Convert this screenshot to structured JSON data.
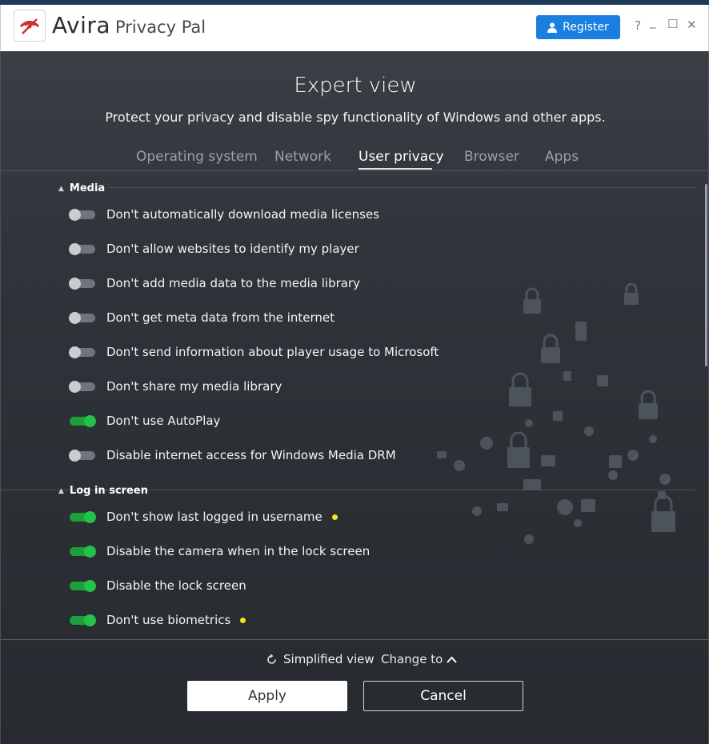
{
  "app": {
    "brand": "Avira",
    "product": "Privacy Pal",
    "register_label": "Register",
    "window_controls": {
      "help": "?",
      "minimize": "_",
      "maximize": "☐",
      "close": "✕"
    }
  },
  "header": {
    "title": "Expert view",
    "subtitle": "Protect your privacy and disable spy functionality of Windows and other apps."
  },
  "tabs": [
    {
      "label": "Operating system",
      "active": false
    },
    {
      "label": "Network",
      "active": false
    },
    {
      "label": "User privacy",
      "active": true
    },
    {
      "label": "Browser",
      "active": false
    },
    {
      "label": "Apps",
      "active": false
    }
  ],
  "sections": [
    {
      "title": "Media",
      "items": [
        {
          "label": "Don't automatically download media licenses",
          "on": false
        },
        {
          "label": "Don't allow websites to identify my player",
          "on": false
        },
        {
          "label": "Don't add media data to the media library",
          "on": false
        },
        {
          "label": "Don't get meta data from the internet",
          "on": false
        },
        {
          "label": "Don't send information about player usage to Microsoft",
          "on": false
        },
        {
          "label": "Don't share my media library",
          "on": false
        },
        {
          "label": "Don't use AutoPlay",
          "on": true
        },
        {
          "label": "Disable internet access for Windows Media DRM",
          "on": false
        }
      ]
    },
    {
      "title": "Log in screen",
      "items": [
        {
          "label": "Don't show last logged in username",
          "on": true,
          "dot": true
        },
        {
          "label": "Disable the camera when in the lock screen",
          "on": true
        },
        {
          "label": "Disable the lock screen",
          "on": true
        },
        {
          "label": "Don't use biometrics",
          "on": true,
          "dot": true
        }
      ]
    }
  ],
  "footer": {
    "simplified_label": "Simplified view",
    "change_label": "Change to",
    "apply_label": "Apply",
    "cancel_label": "Cancel"
  },
  "colors": {
    "accent": "#1a7fe0",
    "toggle_on": "#23c24a",
    "toggle_off": "#c9ccd0",
    "indicator_dot": "#f3e81c",
    "logo_red": "#c9302c"
  },
  "icons": {
    "logo": "avira-umbrella-logo",
    "register": "user-icon",
    "simplified": "refresh-icon",
    "change": "chevron-up-icon"
  }
}
